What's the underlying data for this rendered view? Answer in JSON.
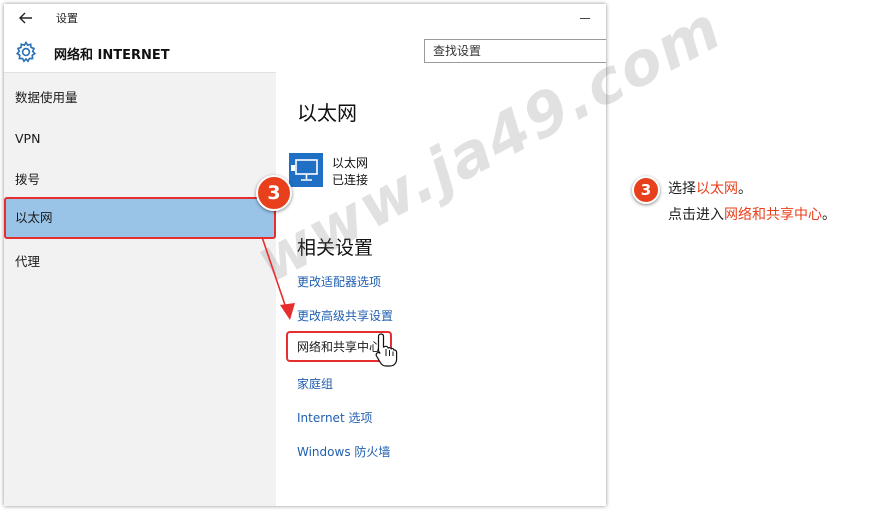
{
  "window": {
    "title": "设置",
    "section_title": "网络和 INTERNET",
    "search_placeholder": "查找设置"
  },
  "sidebar": {
    "items": [
      {
        "label": "数据使用量"
      },
      {
        "label": "VPN"
      },
      {
        "label": "拨号"
      },
      {
        "label": "以太网",
        "selected": true
      },
      {
        "label": "代理"
      }
    ]
  },
  "content": {
    "heading": "以太网",
    "connection": {
      "name": "以太网",
      "status": "已连接"
    },
    "related_heading": "相关设置",
    "links": [
      {
        "label": "更改适配器选项"
      },
      {
        "label": "更改高级共享设置"
      },
      {
        "label": "网络和共享中心",
        "highlighted": true
      },
      {
        "label": "家庭组"
      },
      {
        "label": "Internet 选项"
      },
      {
        "label": "Windows 防火墙"
      }
    ]
  },
  "annotation": {
    "step_number": "3",
    "line1_prefix": "选择",
    "line1_highlight": "以太网",
    "line1_suffix": "。",
    "line2_prefix": "点击进入",
    "line2_highlight": "网络和共享中心",
    "line2_suffix": "。",
    "watermark": "www.ja49.com"
  },
  "colors": {
    "accent_blue": "#1f5fb0",
    "selected_bg": "#99c4e8",
    "annotation_red": "#e62e2e",
    "badge_orange": "#e8401c",
    "sidebar_bg": "#f2f2f2"
  },
  "icons": {
    "back": "arrow-left-icon",
    "gear": "gear-icon",
    "ethernet": "ethernet-monitor-icon",
    "cursor": "hand-pointer-icon"
  }
}
